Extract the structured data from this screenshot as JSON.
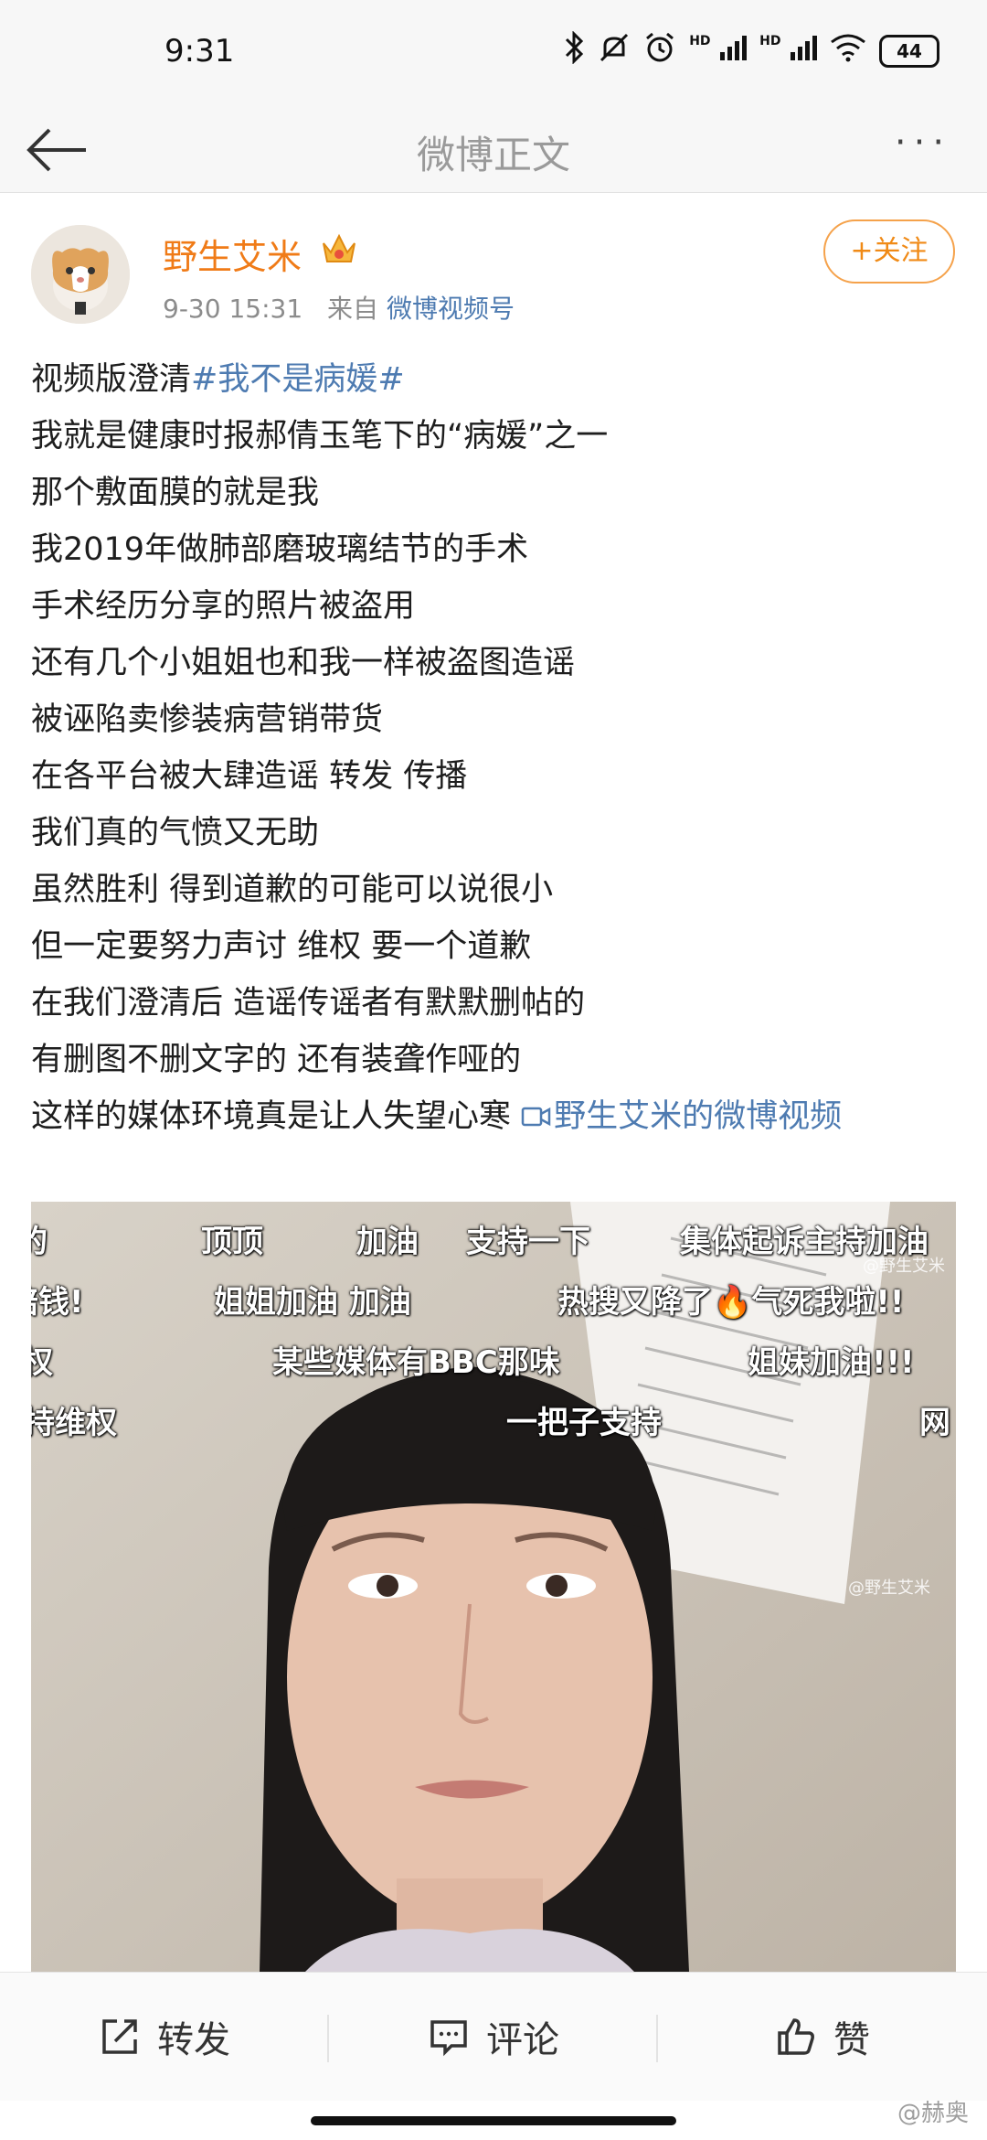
{
  "status_bar": {
    "time": "9:31",
    "hd_label": "HD",
    "battery": "44"
  },
  "nav": {
    "title": "微博正文",
    "more": "···"
  },
  "post": {
    "username": "野生艾米",
    "timestamp": "9-30 15:31",
    "source_prefix": "来自",
    "source": "微博视频号",
    "follow_label": "关注",
    "follow_icon": "+",
    "lines": [
      {
        "text": "视频版澄清",
        "tag": "#我不是病媛#"
      },
      {
        "text": "我就是健康时报郝倩玉笔下的“病媛”之一"
      },
      {
        "text": "那个敷面膜的就是我"
      },
      {
        "text": "我2019年做肺部磨玻璃结节的手术"
      },
      {
        "text": "手术经历分享的照片被盗用"
      },
      {
        "text": "还有几个小姐姐也和我一样被盗图造谣"
      },
      {
        "text": "被诬陷卖惨装病营销带货"
      },
      {
        "text": "在各平台被大肆造谣 转发 传播"
      },
      {
        "text": "我们真的气愤又无助"
      },
      {
        "text": "虽然胜利 得到道歉的可能可以说很小"
      },
      {
        "text": "但一定要努力声讨 维权 要一个道歉"
      },
      {
        "text": "在我们澄清后 造谣传谣者有默默删帖的"
      },
      {
        "text": "有删图不删文字的 还有装聋作哑的"
      },
      {
        "text": "这样的媒体环境真是让人失望心寒 ",
        "link": "野生艾米的微博视频"
      }
    ]
  },
  "video": {
    "danmaku": [
      {
        "text": "的"
      },
      {
        "text": "顶顶"
      },
      {
        "text": "加油"
      },
      {
        "text": "支持一下"
      },
      {
        "text": "集体起诉主持加油"
      },
      {
        "text": "赔钱!"
      },
      {
        "text": "姐姐加油  加油"
      },
      {
        "text": "热搜又降了🔥气死我啦!!"
      },
      {
        "text": "权"
      },
      {
        "text": "某些媒体有BBC那味"
      },
      {
        "text": "姐妹加油!!!"
      },
      {
        "text": "持维权"
      },
      {
        "text": "一把子支持"
      },
      {
        "text": "网"
      }
    ],
    "watermark_top": "@野生艾米",
    "watermark_mid": "@野生艾米"
  },
  "actions": {
    "repost": "转发",
    "comment": "评论",
    "like": "赞"
  },
  "site_watermark": "@赫奥"
}
